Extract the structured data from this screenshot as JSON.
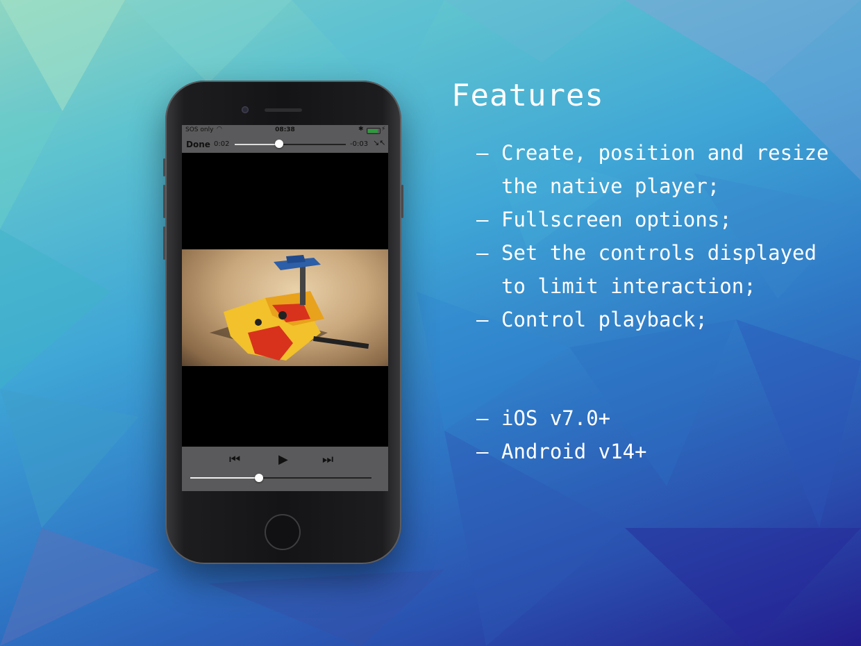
{
  "colors": {
    "accent": "#ffffff",
    "status_green": "#2a9d3a",
    "player_bar": "#5a5a5c"
  },
  "status_bar": {
    "carrier": "SOS only",
    "wifi_icon": "wifi-icon",
    "time": "08:38",
    "bluetooth_icon": "bluetooth-icon",
    "battery_level": 0.85,
    "charging_icon": "bolt-icon"
  },
  "player": {
    "done_label": "Done",
    "elapsed": "0:02",
    "remaining": "-0:03",
    "top_progress": 0.4,
    "bottom_volume": 0.38,
    "exit_fullscreen_icon": "exit-fullscreen-icon",
    "prev_icon": "rewind-icon",
    "play_icon": "play-icon",
    "next_icon": "fast-forward-icon"
  },
  "features": {
    "title": "Features",
    "items": [
      {
        "dash": "–",
        "text": "Create, position and resize the native player;"
      },
      {
        "dash": "–",
        "text": "Fullscreen options;"
      },
      {
        "dash": "–",
        "text": "Set the controls displayed to limit interaction;"
      },
      {
        "dash": "–",
        "text": "Control playback;"
      }
    ],
    "platforms": [
      {
        "dash": "–",
        "text": "iOS v7.0+"
      },
      {
        "dash": "–",
        "text": "Android v14+"
      }
    ]
  }
}
